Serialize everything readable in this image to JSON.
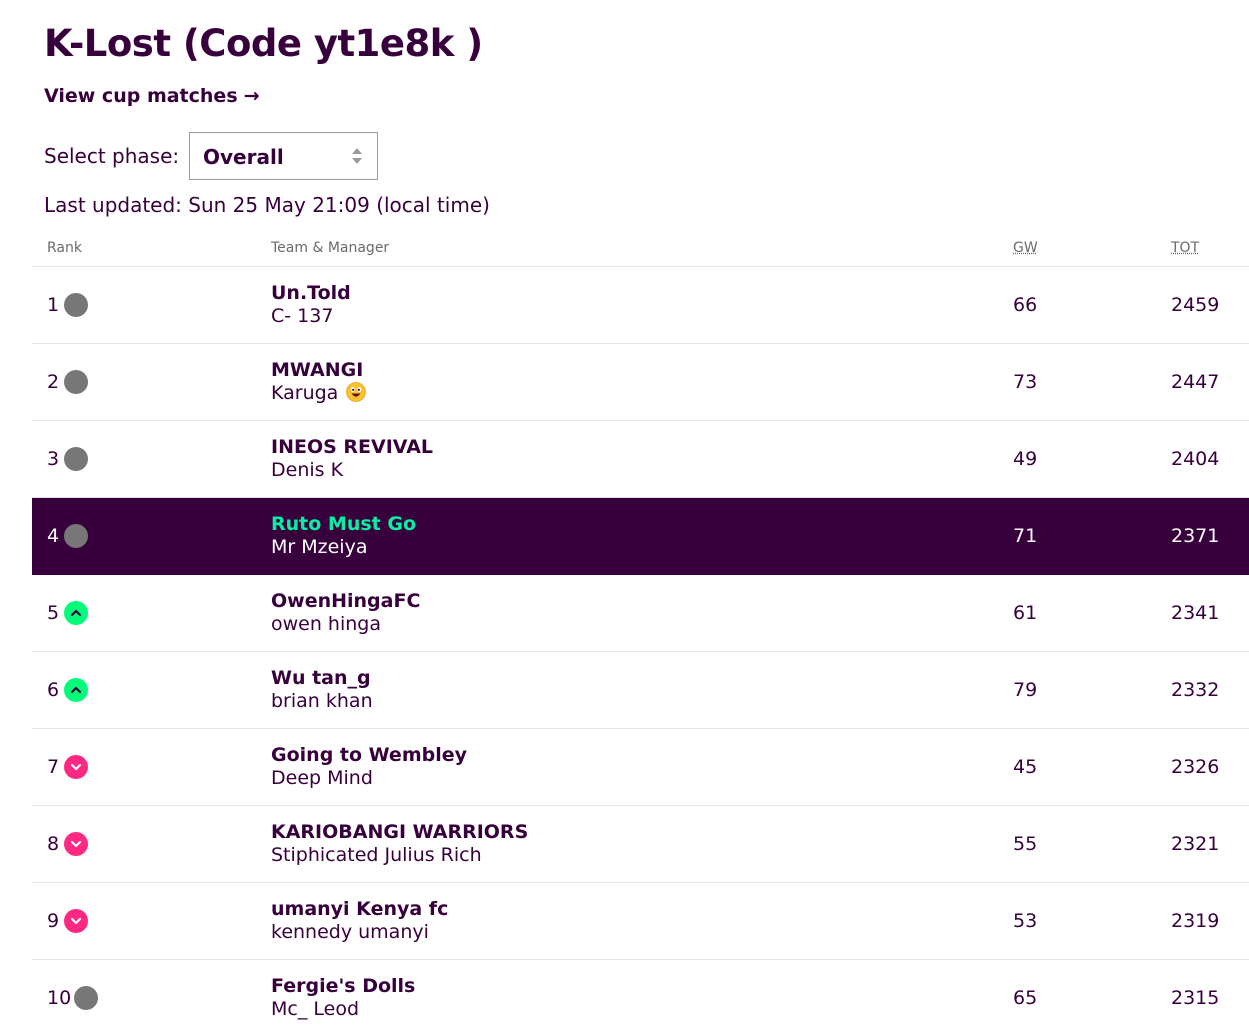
{
  "league": {
    "title": "K-Lost (Code yt1e8k )",
    "cup_link_label": "View cup matches",
    "cup_link_arrow": "→"
  },
  "phase": {
    "label": "Select phase:",
    "selected": "Overall"
  },
  "last_updated": "Last updated: Sun 25 May 21:09 (local time)",
  "table": {
    "headers": {
      "rank": "Rank",
      "team_manager": "Team & Manager",
      "gw": "GW",
      "tot": "TOT"
    },
    "rows": [
      {
        "rank": "1",
        "movement": "same",
        "team": "Un.Told",
        "manager": "C- 137",
        "gw": "66",
        "tot": "2459",
        "selected": false
      },
      {
        "rank": "2",
        "movement": "same",
        "team": "MWANGI",
        "manager": "Karuga",
        "manager_icon": "grinning-emoji-icon",
        "gw": "73",
        "tot": "2447",
        "selected": false
      },
      {
        "rank": "3",
        "movement": "same",
        "team": "INEOS REVIVAL",
        "manager": "Denis K",
        "gw": "49",
        "tot": "2404",
        "selected": false
      },
      {
        "rank": "4",
        "movement": "same",
        "team": "Ruto Must Go",
        "manager": "Mr Mzeiya",
        "gw": "71",
        "tot": "2371",
        "selected": true
      },
      {
        "rank": "5",
        "movement": "up",
        "team": "OwenHingaFC",
        "manager": "owen hinga",
        "gw": "61",
        "tot": "2341",
        "selected": false
      },
      {
        "rank": "6",
        "movement": "up",
        "team": "Wu tan_g",
        "manager": "brian khan",
        "gw": "79",
        "tot": "2332",
        "selected": false
      },
      {
        "rank": "7",
        "movement": "down",
        "team": "Going to Wembley",
        "manager": "Deep Mind",
        "gw": "45",
        "tot": "2326",
        "selected": false
      },
      {
        "rank": "8",
        "movement": "down",
        "team": "KARIOBANGI WARRIORS",
        "manager": "Stiphicated Julius Rich",
        "gw": "55",
        "tot": "2321",
        "selected": false
      },
      {
        "rank": "9",
        "movement": "down",
        "team": "umanyi Kenya fc",
        "manager": "kennedy umanyi",
        "gw": "53",
        "tot": "2319",
        "selected": false
      },
      {
        "rank": "10",
        "movement": "same",
        "team": "Fergie's Dolls",
        "manager": "Mc_ Leod",
        "gw": "65",
        "tot": "2315",
        "selected": false
      }
    ]
  },
  "colors": {
    "primary": "#37003c",
    "highlight_team": "#05f0a5",
    "move_same": "#777777",
    "move_up": "#01fc7a",
    "move_down": "#ff2882",
    "divider": "#e5e5e5"
  }
}
